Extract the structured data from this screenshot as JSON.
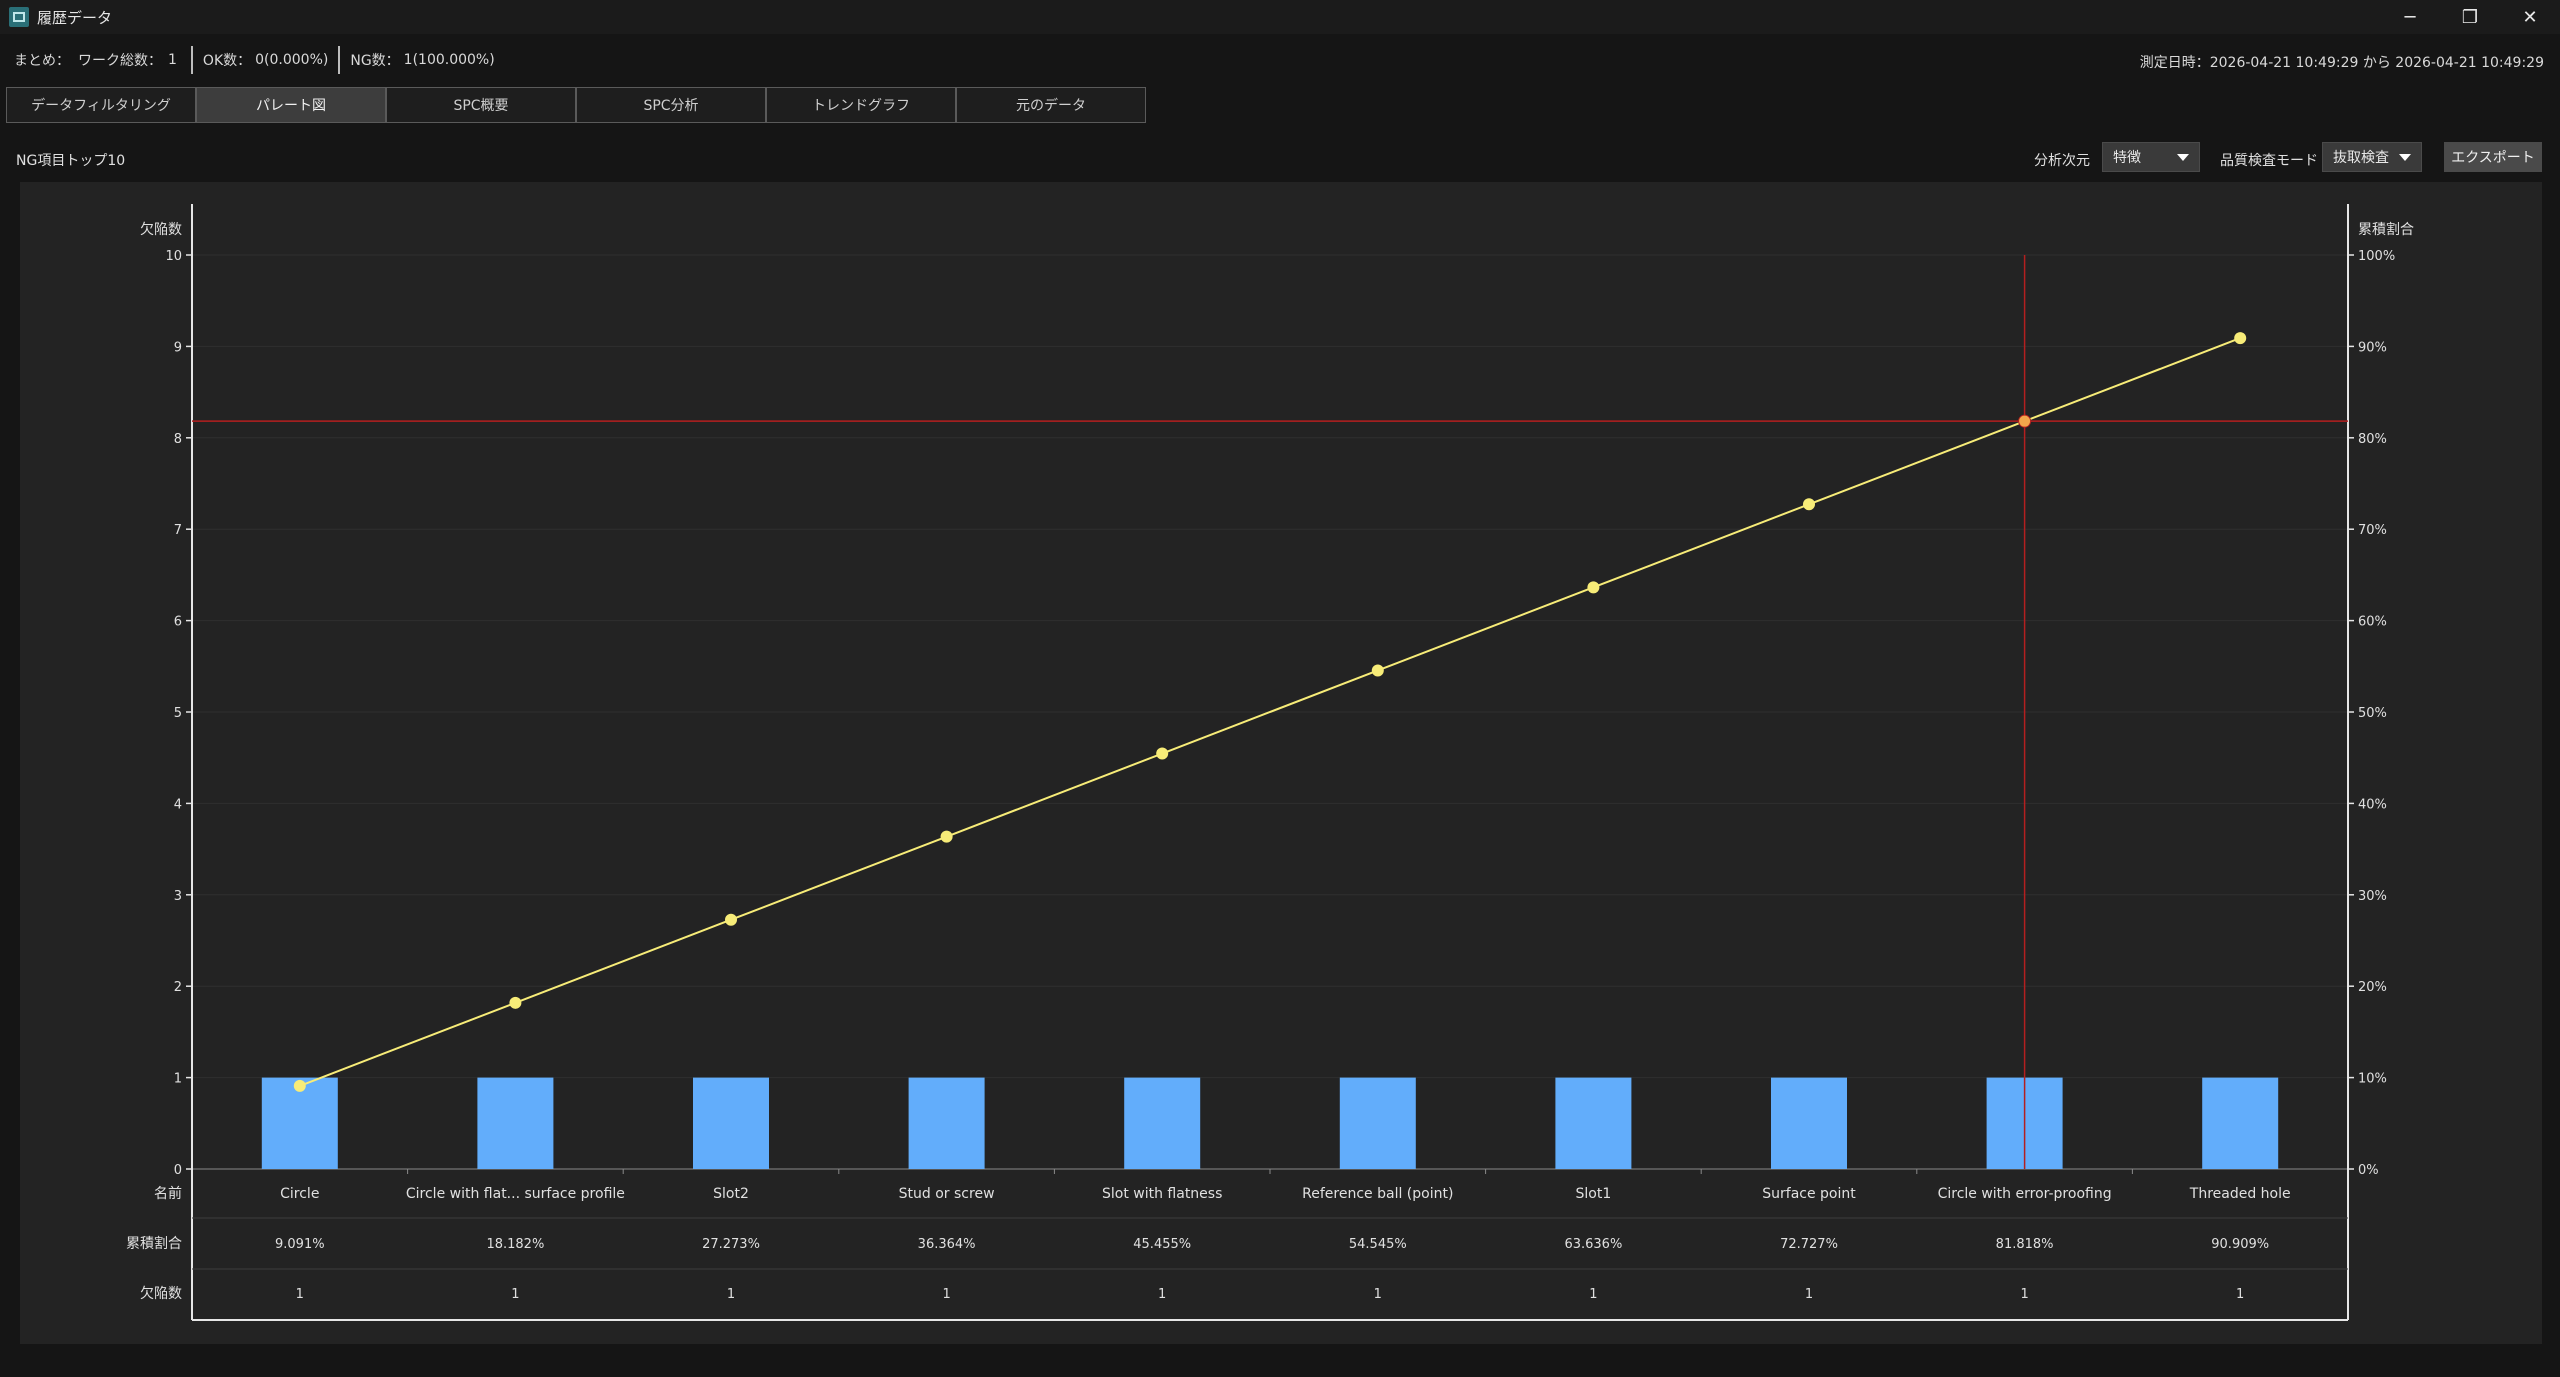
{
  "window": {
    "title": "履歴データ",
    "controls": [
      "minimize-icon",
      "restore-icon",
      "close-icon"
    ],
    "control_glyphs": [
      "─",
      "❐",
      "✕"
    ]
  },
  "summary": {
    "label": "まとめ：",
    "total_label": "ワーク総数：",
    "total_value": "1",
    "ok_label": "OK数：",
    "ok_value": "0(0.000%)",
    "ng_label": "NG数：",
    "ng_value": "1(100.000%)",
    "measure_time": "測定日時：2026-04-21 10:49:29 から 2026-04-21 10:49:29"
  },
  "tabs": [
    {
      "label": "データフィルタリング",
      "active": false
    },
    {
      "label": "パレート図",
      "active": true
    },
    {
      "label": "SPC概要",
      "active": false
    },
    {
      "label": "SPC分析",
      "active": false
    },
    {
      "label": "トレンドグラフ",
      "active": false
    },
    {
      "label": "元のデータ",
      "active": false
    }
  ],
  "toolbar": {
    "section_title": "NG項目トップ10",
    "dimension_label": "分析次元",
    "dimension_value": "特徴",
    "mode_label": "品質検査モード",
    "mode_value": "抜取検査",
    "export_label": "エクスポート"
  },
  "colors": {
    "bar": "#62adfb",
    "line": "#f7ec78",
    "crosshair": "#b41f1f",
    "axis": "#e6e6e6"
  },
  "chart_data": {
    "type": "bar",
    "left_axis_title": "欠陥数",
    "right_axis_title": "累積割合",
    "ylim": [
      0,
      10
    ],
    "y_ticks": [
      "0",
      "1",
      "2",
      "3",
      "4",
      "5",
      "6",
      "7",
      "8",
      "9",
      "10"
    ],
    "y2lim": [
      0,
      100
    ],
    "y2_ticks": [
      "0%",
      "10%",
      "20%",
      "30%",
      "40%",
      "50%",
      "60%",
      "70%",
      "80%",
      "90%",
      "100%"
    ],
    "grid": true,
    "categories": [
      "Circle",
      "Circle with flat... surface profile",
      "Slot2",
      "Stud or screw",
      "Slot with flatness",
      "Reference ball (point)",
      "Slot1",
      "Surface point",
      "Circle with error-proofing",
      "Threaded hole"
    ],
    "series": [
      {
        "name": "欠陥数",
        "type": "bar",
        "axis": "left",
        "values": [
          1,
          1,
          1,
          1,
          1,
          1,
          1,
          1,
          1,
          1
        ]
      },
      {
        "name": "累積割合",
        "type": "line",
        "axis": "right",
        "values": [
          9.091,
          18.182,
          27.273,
          36.364,
          45.455,
          54.545,
          63.636,
          72.727,
          81.818,
          90.909
        ]
      }
    ],
    "crosshair": {
      "category_index": 8,
      "y2_value": 81.818
    },
    "table": {
      "row_labels": [
        "名前",
        "累積割合",
        "欠陥数"
      ],
      "cumulative": [
        "9.091%",
        "18.182%",
        "27.273%",
        "36.364%",
        "45.455%",
        "54.545%",
        "63.636%",
        "72.727%",
        "81.818%",
        "90.909%"
      ],
      "counts": [
        "1",
        "1",
        "1",
        "1",
        "1",
        "1",
        "1",
        "1",
        "1",
        "1"
      ]
    }
  }
}
